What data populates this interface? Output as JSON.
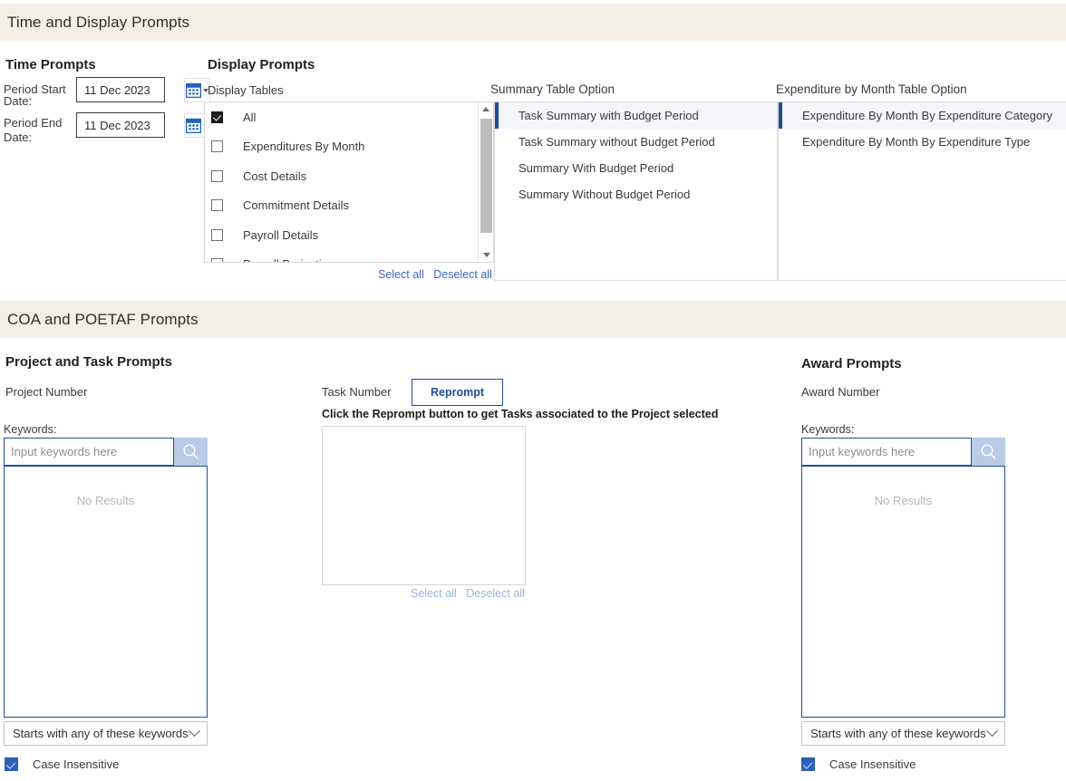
{
  "sections": {
    "time_display": {
      "title": "Time and Display Prompts"
    },
    "coa_poetaf": {
      "title": "COA and POETAF Prompts"
    }
  },
  "time_prompts": {
    "heading": "Time Prompts",
    "start_label": "Period Start Date:",
    "start_value": "11 Dec 2023",
    "end_label": "Period End Date:",
    "end_value": "11 Dec 2023",
    "calendar_icon": "calendar-icon"
  },
  "display_prompts": {
    "heading": "Display Prompts",
    "list_label": "Display Tables",
    "items": [
      {
        "label": "All",
        "checked": true
      },
      {
        "label": "Expenditures By Month",
        "checked": false
      },
      {
        "label": "Cost Details",
        "checked": false
      },
      {
        "label": "Commitment Details",
        "checked": false
      },
      {
        "label": "Payroll Details",
        "checked": false
      },
      {
        "label": "Payroll Projections",
        "checked": false
      }
    ],
    "select_all": "Select all",
    "deselect_all": "Deselect all"
  },
  "summary_table_option": {
    "heading": "Summary Table Option",
    "options": [
      "Task Summary with Budget Period",
      "Task Summary without Budget Period",
      "Summary With Budget Period",
      "Summary Without Budget Period"
    ],
    "selected_index": 0
  },
  "expenditure_table_option": {
    "heading": "Expenditure by Month Table Option",
    "options": [
      "Expenditure By Month By Expenditure Category",
      "Expenditure By Month By Expenditure Type"
    ],
    "selected_index": 0
  },
  "project_task": {
    "heading": "Project and Task Prompts",
    "project_number_label": "Project Number",
    "keywords_label": "Keywords:",
    "keywords_placeholder": "Input keywords here",
    "keywords_value": "",
    "search_icon": "search-icon",
    "no_results": "No Results",
    "match_mode": "Starts with any of these keywords",
    "case_insensitive_label": "Case Insensitive",
    "task_number_label": "Task Number",
    "reprompt_label": "Reprompt",
    "reprompt_hint": "Click the Reprompt button to get Tasks associated to the Project selected",
    "select_all": "Select all",
    "deselect_all": "Deselect all"
  },
  "award": {
    "heading": "Award Prompts",
    "award_number_label": "Award Number",
    "keywords_label": "Keywords:",
    "keywords_placeholder": "Input keywords here",
    "keywords_value": "",
    "search_icon": "search-icon",
    "no_results": "No Results",
    "match_mode": "Starts with any of these keywords",
    "case_insensitive_label": "Case Insensitive"
  },
  "colors": {
    "section_bar": "#f3efe5",
    "accent_blue": "#1f4e96",
    "link_blue": "#3b68c4",
    "selected_row_bg": "#f4f6fa",
    "search_button": "#b9cbe6"
  }
}
